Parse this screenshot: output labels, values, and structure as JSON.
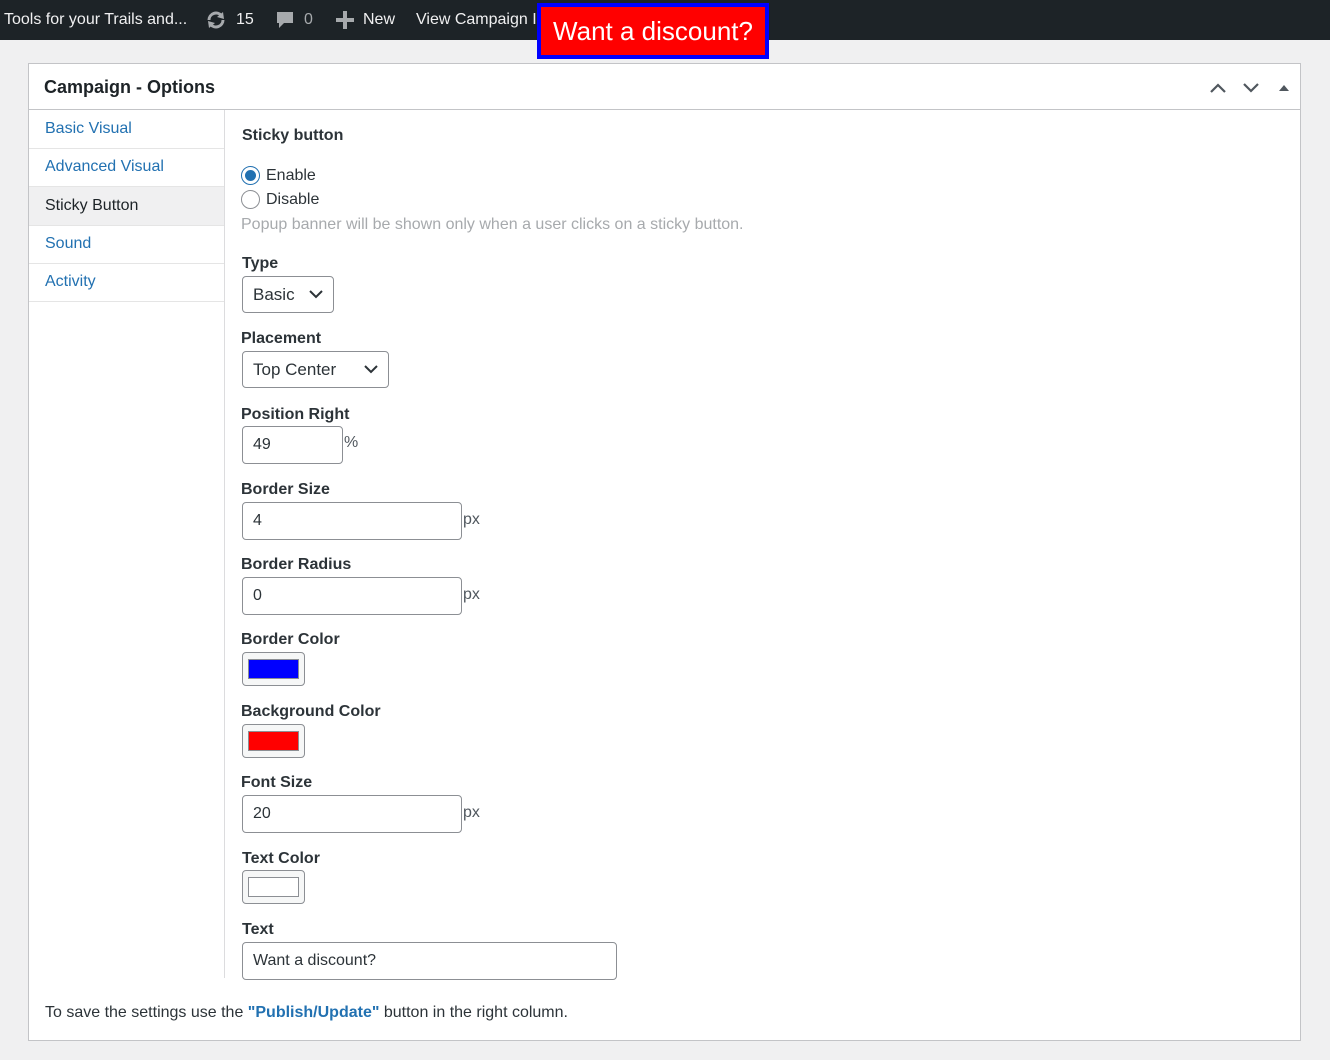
{
  "adminbar": {
    "site_name": "Tools for your Trails and...",
    "updates_count": "15",
    "comments_count": "0",
    "new_label": "New",
    "view_label": "View Campaign I"
  },
  "sticky_preview": {
    "text": "Want a discount?",
    "background_color": "#ff0000",
    "border_color": "#0000ff",
    "text_color": "#ffffff"
  },
  "postbox": {
    "title": "Campaign - Options"
  },
  "tabs": [
    {
      "label": "Basic Visual"
    },
    {
      "label": "Advanced Visual"
    },
    {
      "label": "Sticky Button"
    },
    {
      "label": "Sound"
    },
    {
      "label": "Activity"
    }
  ],
  "active_tab": "Sticky Button",
  "panel": {
    "heading": "Sticky button",
    "enable_label": "Enable",
    "disable_label": "Disable",
    "enabled": true,
    "description": "Popup banner will be shown only when a user clicks on a sticky button.",
    "type_label": "Type",
    "type_value": "Basic",
    "placement_label": "Placement",
    "placement_value": "Top Center",
    "position_right_label": "Position Right",
    "position_right_value": "49",
    "position_right_unit": "%",
    "border_size_label": "Border Size",
    "border_size_value": "4",
    "border_radius_label": "Border Radius",
    "border_radius_value": "0",
    "px_unit": "px",
    "border_color_label": "Border Color",
    "border_color": "#0000ff",
    "background_color_label": "Background Color",
    "background_color": "#ff0000",
    "font_size_label": "Font Size",
    "font_size_value": "20",
    "text_color_label": "Text Color",
    "text_color": "#ffffff",
    "text_label": "Text",
    "text_value": "Want a discount?"
  },
  "footer": {
    "prefix": "To save the settings use the ",
    "link": "\"Publish/Update\"",
    "suffix": " button in the right column."
  }
}
